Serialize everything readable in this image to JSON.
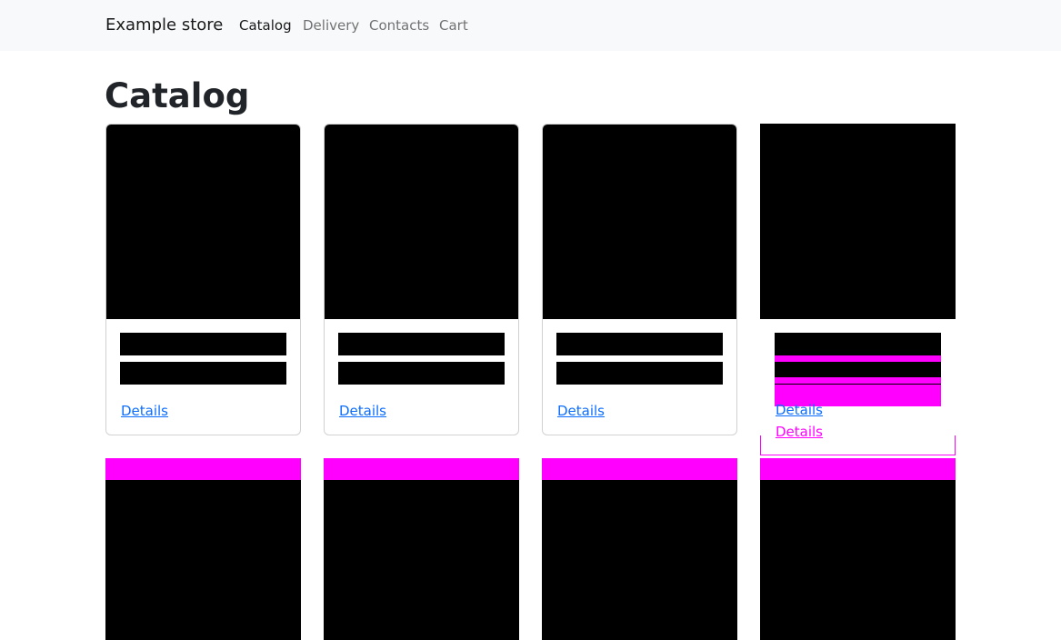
{
  "navbar": {
    "brand": "Example store",
    "links": [
      {
        "label": "Catalog",
        "active": true
      },
      {
        "label": "Delivery",
        "active": false
      },
      {
        "label": "Contacts",
        "active": false
      },
      {
        "label": "Cart",
        "active": false
      }
    ]
  },
  "main": {
    "title": "Catalog",
    "cards": [
      {
        "link_label": "Details"
      },
      {
        "link_label": "Details"
      },
      {
        "link_label": "Details"
      },
      {
        "link_label": "Details",
        "ghost_link_label": "Details"
      }
    ]
  },
  "colors": {
    "link": "#0d6efd",
    "glitch": "#ff00ff",
    "navbar_bg": "#f8f9fa"
  }
}
